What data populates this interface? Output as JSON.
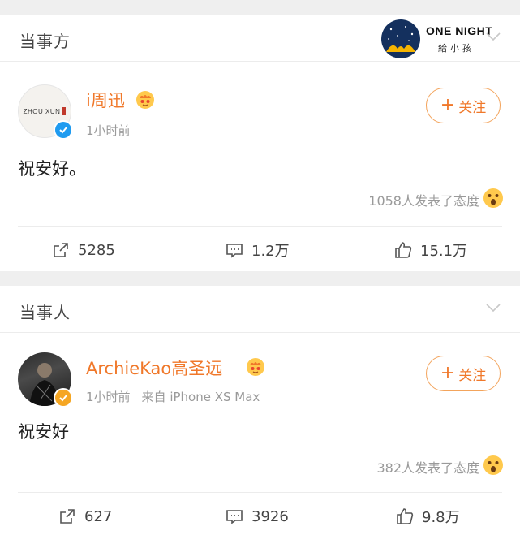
{
  "sections": [
    {
      "title": "当事方",
      "banner": {
        "line1": "ONE NIGHT",
        "line2": "給小孩"
      },
      "post": {
        "avatar_text": "ZHOU XUN",
        "username": "i周迅",
        "time": "1小时前",
        "source": "",
        "follow_label": "关注",
        "text": "祝安好。",
        "reactions": "1058人发表了态度",
        "reposts": "5285",
        "comments": "1.2万",
        "likes": "15.1万",
        "verify_color": "#1f9bf0"
      }
    },
    {
      "title": "当事人",
      "post": {
        "username": "ArchieKao高圣远",
        "time": "1小时前",
        "source": "来自 iPhone XS Max",
        "follow_label": "关注",
        "text": "祝安好",
        "reactions": "382人发表了态度",
        "reposts": "627",
        "comments": "3926",
        "likes": "9.8万",
        "verify_color": "#f5a623"
      }
    }
  ],
  "colors": {
    "accent": "#f0782a",
    "muted": "#9a9a9a",
    "gap": "#efefef"
  }
}
